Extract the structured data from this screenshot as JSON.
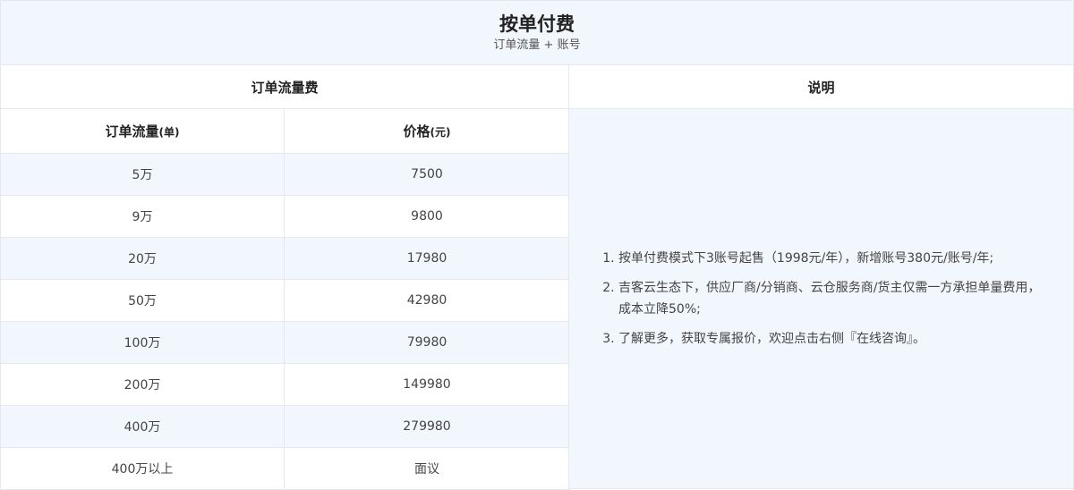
{
  "header": {
    "title": "按单付费",
    "subtitle": "订单流量 + 账号"
  },
  "fee_section": {
    "title": "订单流量费",
    "columns": [
      {
        "label": "订单流量",
        "unit": "(单)"
      },
      {
        "label": "价格",
        "unit": "(元)"
      }
    ],
    "rows": [
      {
        "volume": "5万",
        "price": "7500"
      },
      {
        "volume": "9万",
        "price": "9800"
      },
      {
        "volume": "20万",
        "price": "17980"
      },
      {
        "volume": "50万",
        "price": "42980"
      },
      {
        "volume": "100万",
        "price": "79980"
      },
      {
        "volume": "200万",
        "price": "149980"
      },
      {
        "volume": "400万",
        "price": "279980"
      },
      {
        "volume": "400万以上",
        "price": "面议"
      }
    ]
  },
  "notes_section": {
    "title": "说明",
    "items": [
      "按单付费模式下3账号起售（1998元/年），新增账号380元/账号/年;",
      "吉客云生态下，供应厂商/分销商、云仓服务商/货主仅需一方承担单量费用，成本立降50%;",
      "了解更多，获取专属报价，欢迎点击右侧『在线咨询』。"
    ]
  }
}
